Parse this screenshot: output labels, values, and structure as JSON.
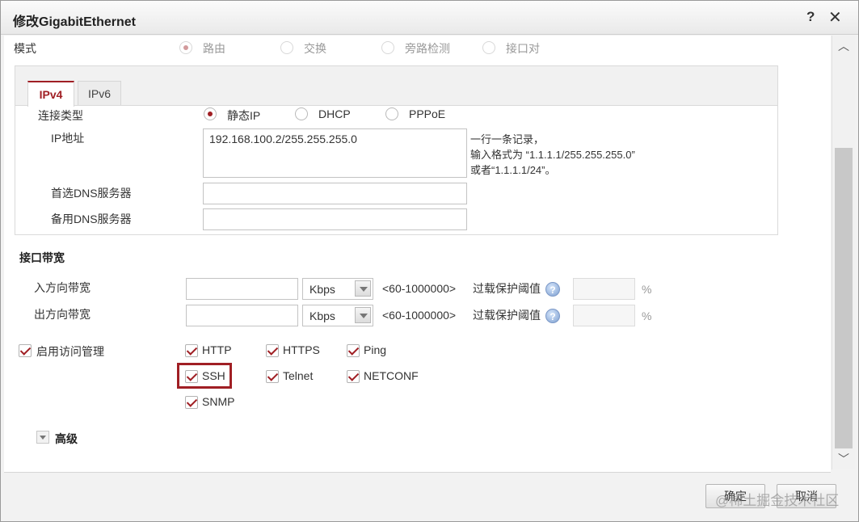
{
  "window": {
    "title": "修改GigabitEthernet",
    "help_label": "?",
    "close_label": "✕"
  },
  "mode": {
    "label": "模式",
    "options": [
      {
        "label": "路由",
        "selected": true
      },
      {
        "label": "交换",
        "selected": false
      },
      {
        "label": "旁路检测",
        "selected": false
      },
      {
        "label": "接口对",
        "selected": false
      }
    ]
  },
  "ip_tabs": [
    {
      "label": "IPv4",
      "active": true
    },
    {
      "label": "IPv6",
      "active": false
    }
  ],
  "ipv4": {
    "conn_type_label": "连接类型",
    "conn_types": [
      {
        "label": "静态IP",
        "selected": true
      },
      {
        "label": "DHCP",
        "selected": false
      },
      {
        "label": "PPPoE",
        "selected": false
      }
    ],
    "ip_label": "IP地址",
    "ip_value": "192.168.100.2/255.255.255.0",
    "ip_hint_1": "一行一条记录，",
    "ip_hint_2": "输入格式为 “1.1.1.1/255.255.255.0”",
    "ip_hint_3": "或者“1.1.1.1/24”。",
    "dns1_label": "首选DNS服务器",
    "dns1_value": "",
    "dns2_label": "备用DNS服务器",
    "dns2_value": ""
  },
  "bandwidth": {
    "section_title": "接口带宽",
    "rows": [
      {
        "label": "入方向带宽",
        "value": "",
        "unit": "Kbps",
        "range": "<60-1000000>",
        "protect_label": "过载保护阈值",
        "protect_value": "",
        "percent": "%"
      },
      {
        "label": "出方向带宽",
        "value": "",
        "unit": "Kbps",
        "range": "<60-1000000>",
        "protect_label": "过载保护阈值",
        "protect_value": "",
        "percent": "%"
      }
    ],
    "help_icon": "?"
  },
  "access": {
    "label": "启用访问管理",
    "checked": true,
    "protocols": [
      {
        "label": "HTTP",
        "checked": true
      },
      {
        "label": "HTTPS",
        "checked": true
      },
      {
        "label": "Ping",
        "checked": true
      },
      {
        "label": "SSH",
        "checked": true
      },
      {
        "label": "Telnet",
        "checked": true
      },
      {
        "label": "NETCONF",
        "checked": true
      },
      {
        "label": "SNMP",
        "checked": true
      }
    ]
  },
  "advanced": {
    "label": "高级"
  },
  "footer": {
    "ok_label": "确定",
    "cancel_label": "取消"
  },
  "watermark": "@稀土掘金技术社区",
  "colors": {
    "accent": "#a01f24",
    "border": "#c3c3c3",
    "panel_bg": "#f2f2f2"
  }
}
